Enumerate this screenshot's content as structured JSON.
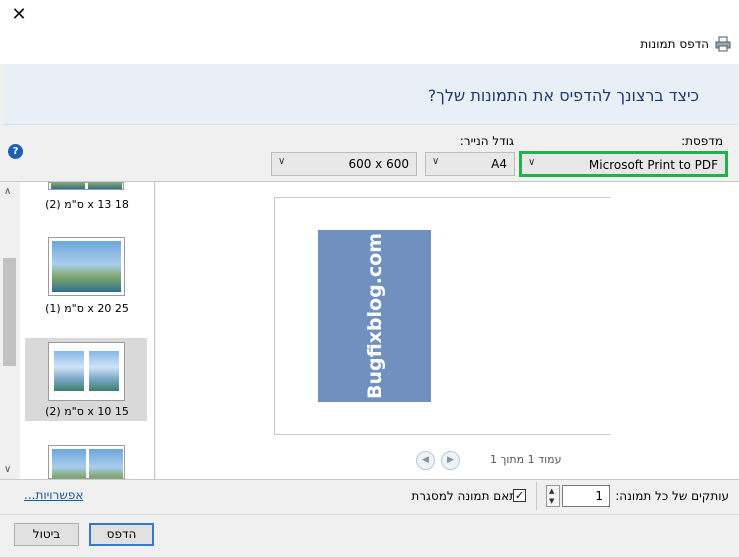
{
  "window": {
    "title": "הדפס תמונות",
    "close_glyph": "✕"
  },
  "header": {
    "question": "כיצד ברצונך להדפיס את התמונות שלך?"
  },
  "printer": {
    "label": "מדפסת:",
    "value": "Microsoft Print to PDF"
  },
  "paper": {
    "label": "גודל הנייר:",
    "value": "A4"
  },
  "quality": {
    "value": "600 x 600"
  },
  "layouts": {
    "items": [
      {
        "label": "18 x 13 ס\"מ (2)"
      },
      {
        "label": "25 x 20 ס\"מ (1)"
      },
      {
        "label": "15 x 10 ס\"מ (2)",
        "selected": true
      }
    ]
  },
  "preview": {
    "watermark": "Bugfixblog.com",
    "page_status": "עמוד 1 מתוך 1"
  },
  "options": {
    "copies_label": "עותקים של כל תמונה:",
    "copies_value": "1",
    "fit_label": "התאם תמונה למסגרת",
    "fit_checked": true,
    "options_link": "אפשרויות..."
  },
  "buttons": {
    "print": "הדפס",
    "cancel": "ביטול"
  },
  "icons": {
    "help": "help-icon",
    "printer": "printer-icon"
  },
  "colors": {
    "highlight_border": "#22b24c",
    "header_band": "#e8eff7",
    "question_text": "#1b3b6f",
    "preview_photo": "#7090c0"
  }
}
